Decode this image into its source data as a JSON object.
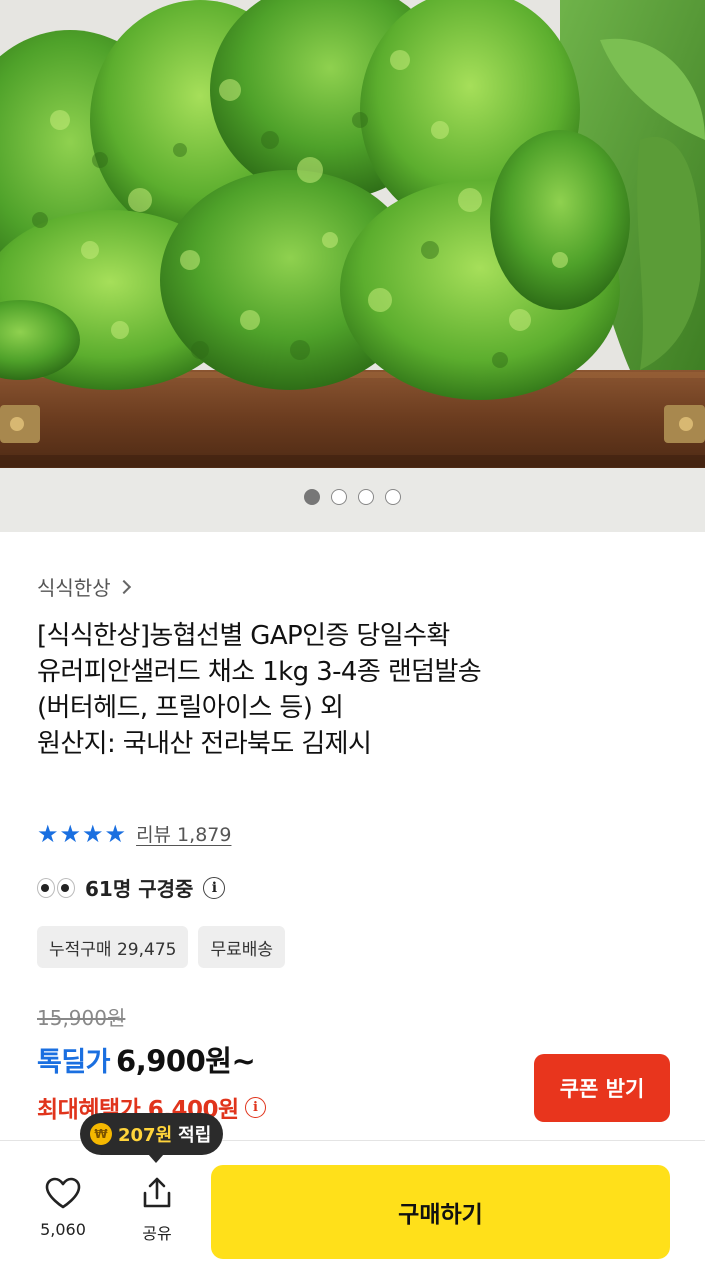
{
  "gallery": {
    "image_icon": "lettuce-product-photo",
    "dot_count": 4,
    "active_dot": 1
  },
  "seller": {
    "name": "식식한상"
  },
  "product": {
    "title_lines": [
      "[식식한상]농협선별 GAP인증 당일수확",
      "유러피안샐러드 채소 1kg 3-4종 랜덤발송",
      "(버터헤드, 프릴아이스 등) 외",
      "원산지: 국내산 전라북도 김제시"
    ]
  },
  "rating": {
    "stars": 4,
    "star_color": "#1a6fe0",
    "review_label": "리뷰 1,879"
  },
  "watching": {
    "text": "61명 구경중"
  },
  "tags": [
    "누적구매 29,475",
    "무료배송"
  ],
  "price": {
    "original": "15,900원",
    "deal_label": "톡딜가",
    "deal_price": "6,900원~",
    "max_benefit": "최대혜택가 6,400원"
  },
  "coupon_button": {
    "label": "쿠폰 받기",
    "color": "#e8351d"
  },
  "points_tooltip": {
    "amount": "207원",
    "suffix": "적립"
  },
  "bottom_bar": {
    "like_count": "5,060",
    "share_label": "공유",
    "buy_label": "구매하기",
    "buy_color": "#ffe01a"
  }
}
